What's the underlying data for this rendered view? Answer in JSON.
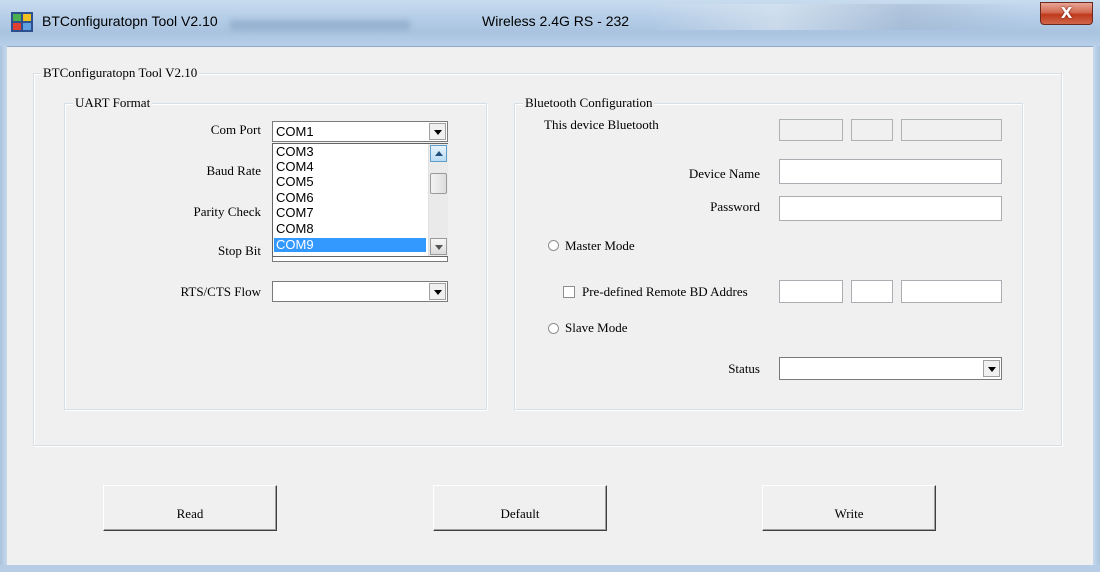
{
  "window": {
    "title": "BTConfiguratopn Tool V2.10",
    "subtitle": "Wireless 2.4G RS - 232",
    "close_label": "X"
  },
  "main_group": {
    "label": "BTConfiguratopn Tool V2.10"
  },
  "uart": {
    "label": "UART Format",
    "com_port_label": "Com Port",
    "com_port_value": "COM1",
    "baud_rate_label": "Baud Rate",
    "parity_label": "Parity Check",
    "stop_bit_label": "Stop Bit",
    "rts_label": "RTS/CTS Flow",
    "rts_value": "",
    "dropdown_items": [
      "COM3",
      "COM4",
      "COM5",
      "COM6",
      "COM7",
      "COM8",
      "COM9"
    ],
    "dropdown_selected": "COM9"
  },
  "bluetooth": {
    "label": "Bluetooth Configuration",
    "this_device_label": "This device Bluetooth",
    "device_name_label": "Device Name",
    "device_name_value": "",
    "password_label": "Password",
    "password_value": "",
    "master_mode_label": "Master Mode",
    "predefined_label": "Pre-defined Remote BD Addres",
    "slave_mode_label": "Slave Mode",
    "status_label": "Status",
    "status_value": ""
  },
  "buttons": {
    "read": "Read",
    "default": "Default",
    "write": "Write"
  },
  "colors": {
    "selection": "#3399ff",
    "window_bg": "#f0f0f0",
    "titlebar": "#b5cde7",
    "close_button": "#c0391c"
  },
  "icons": [
    "app-icon",
    "close-icon",
    "chevron-down-icon",
    "scroll-up-icon",
    "scroll-down-icon"
  ]
}
